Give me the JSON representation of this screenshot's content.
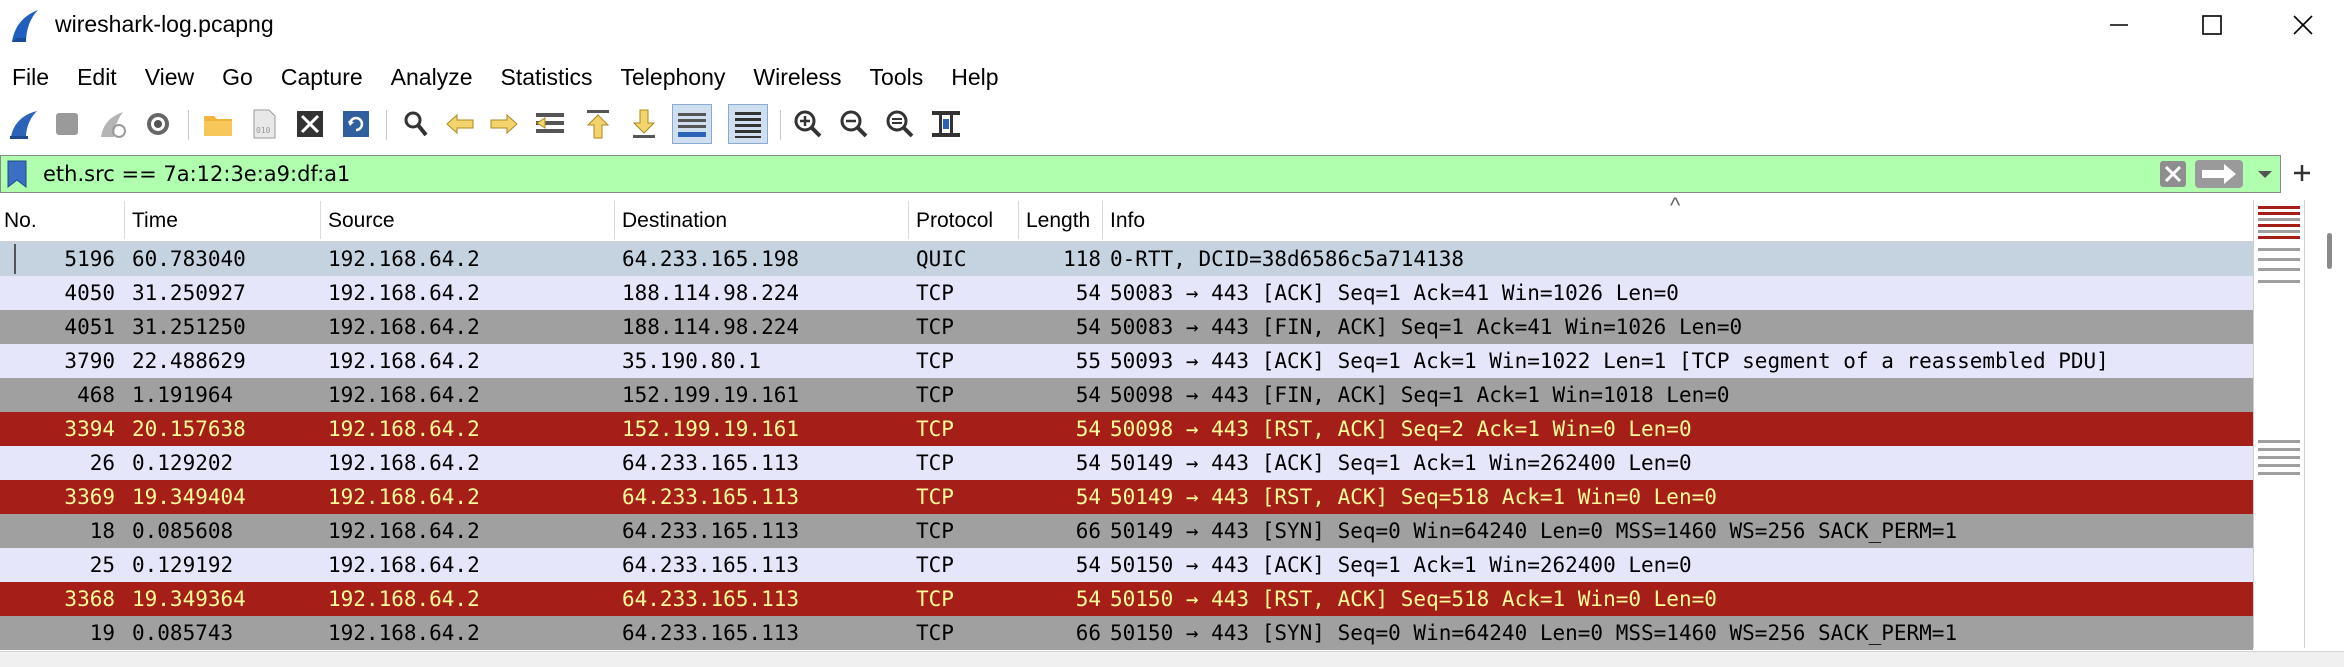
{
  "window": {
    "title": "wireshark-log.pcapng"
  },
  "menu": [
    "File",
    "Edit",
    "View",
    "Go",
    "Capture",
    "Analyze",
    "Statistics",
    "Telephony",
    "Wireless",
    "Tools",
    "Help"
  ],
  "filter": {
    "text": "eth.src == 7a:12:3e:a9:df:a1"
  },
  "columns": {
    "no": "No.",
    "time": "Time",
    "source": "Source",
    "destination": "Destination",
    "protocol": "Protocol",
    "length": "Length",
    "info": "Info"
  },
  "colors": {
    "quic": "#c5d2e0",
    "tcp_light": "#e6e6fb",
    "tcp_gray": "#a0a0a0",
    "rst_bg": "#a51f18",
    "rst_fg": "#fffc9c",
    "filter_bg": "#afffaf"
  },
  "packets": [
    {
      "no": "5196",
      "time": "60.783040",
      "source": "192.168.64.2",
      "destination": "64.233.165.198",
      "protocol": "QUIC",
      "length": "118",
      "info": "0-RTT, DCID=38d6586c5a714138",
      "style": "quic"
    },
    {
      "no": "4050",
      "time": "31.250927",
      "source": "192.168.64.2",
      "destination": "188.114.98.224",
      "protocol": "TCP",
      "length": "54",
      "info": "50083 → 443 [ACK] Seq=1 Ack=41 Win=1026 Len=0",
      "style": "tcp_light"
    },
    {
      "no": "4051",
      "time": "31.251250",
      "source": "192.168.64.2",
      "destination": "188.114.98.224",
      "protocol": "TCP",
      "length": "54",
      "info": "50083 → 443 [FIN, ACK] Seq=1 Ack=41 Win=1026 Len=0",
      "style": "tcp_gray"
    },
    {
      "no": "3790",
      "time": "22.488629",
      "source": "192.168.64.2",
      "destination": "35.190.80.1",
      "protocol": "TCP",
      "length": "55",
      "info": "50093 → 443 [ACK] Seq=1 Ack=1 Win=1022 Len=1 [TCP segment of a reassembled PDU]",
      "style": "tcp_light"
    },
    {
      "no": "468",
      "time": "1.191964",
      "source": "192.168.64.2",
      "destination": "152.199.19.161",
      "protocol": "TCP",
      "length": "54",
      "info": "50098 → 443 [FIN, ACK] Seq=1 Ack=1 Win=1018 Len=0",
      "style": "tcp_gray"
    },
    {
      "no": "3394",
      "time": "20.157638",
      "source": "192.168.64.2",
      "destination": "152.199.19.161",
      "protocol": "TCP",
      "length": "54",
      "info": "50098 → 443 [RST, ACK] Seq=2 Ack=1 Win=0 Len=0",
      "style": "rst"
    },
    {
      "no": "26",
      "time": "0.129202",
      "source": "192.168.64.2",
      "destination": "64.233.165.113",
      "protocol": "TCP",
      "length": "54",
      "info": "50149 → 443 [ACK] Seq=1 Ack=1 Win=262400 Len=0",
      "style": "tcp_light"
    },
    {
      "no": "3369",
      "time": "19.349404",
      "source": "192.168.64.2",
      "destination": "64.233.165.113",
      "protocol": "TCP",
      "length": "54",
      "info": "50149 → 443 [RST, ACK] Seq=518 Ack=1 Win=0 Len=0",
      "style": "rst"
    },
    {
      "no": "18",
      "time": "0.085608",
      "source": "192.168.64.2",
      "destination": "64.233.165.113",
      "protocol": "TCP",
      "length": "66",
      "info": "50149 → 443 [SYN] Seq=0 Win=64240 Len=0 MSS=1460 WS=256 SACK_PERM=1",
      "style": "tcp_gray"
    },
    {
      "no": "25",
      "time": "0.129192",
      "source": "192.168.64.2",
      "destination": "64.233.165.113",
      "protocol": "TCP",
      "length": "54",
      "info": "50150 → 443 [ACK] Seq=1 Ack=1 Win=262400 Len=0",
      "style": "tcp_light"
    },
    {
      "no": "3368",
      "time": "19.349364",
      "source": "192.168.64.2",
      "destination": "64.233.165.113",
      "protocol": "TCP",
      "length": "54",
      "info": "50150 → 443 [RST, ACK] Seq=518 Ack=1 Win=0 Len=0",
      "style": "rst"
    },
    {
      "no": "19",
      "time": "0.085743",
      "source": "192.168.64.2",
      "destination": "64.233.165.113",
      "protocol": "TCP",
      "length": "66",
      "info": "50150 → 443 [SYN] Seq=0 Win=64240 Len=0 MSS=1460 WS=256 SACK_PERM=1",
      "style": "tcp_gray"
    }
  ]
}
